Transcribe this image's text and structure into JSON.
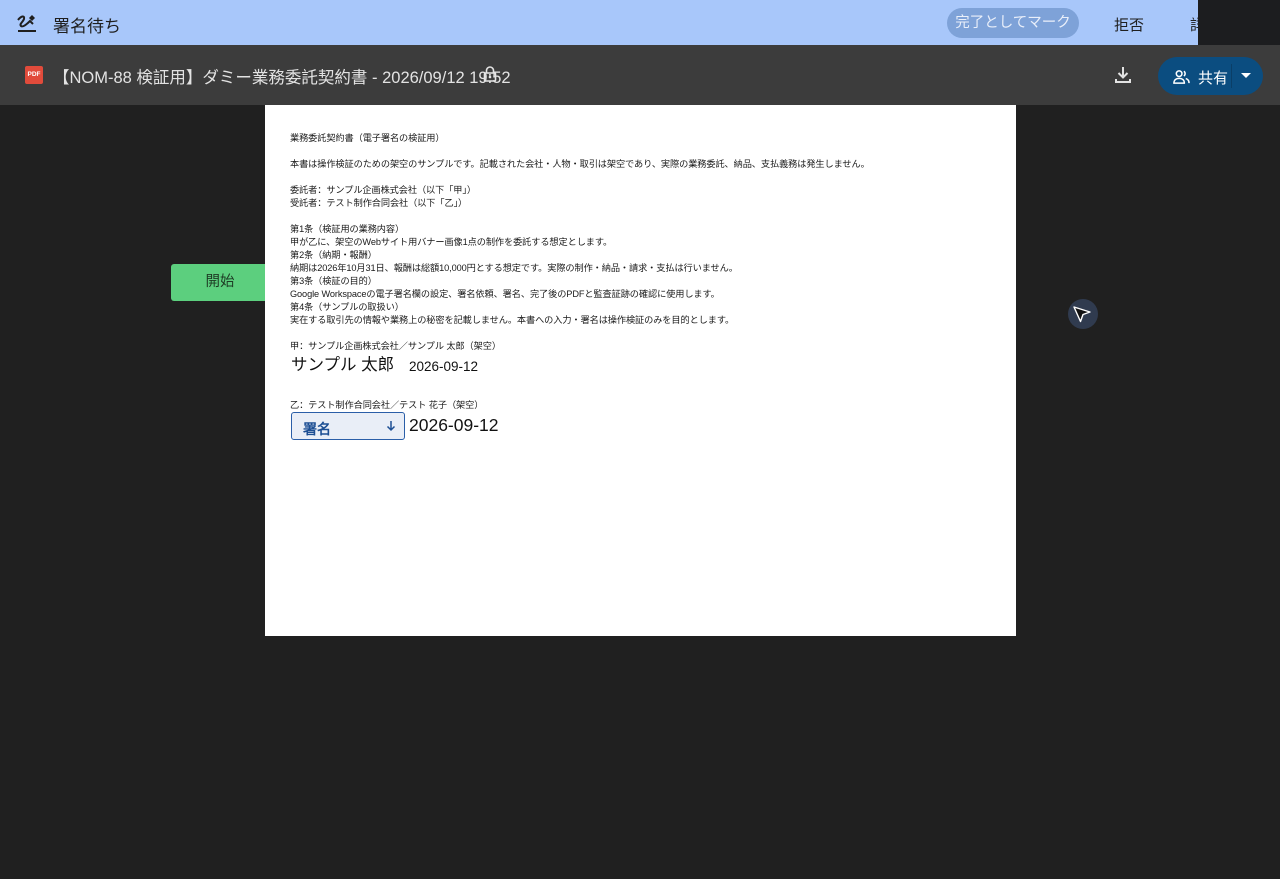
{
  "sign_bar": {
    "title": "署名待ち",
    "mark_done_label": "完了としてマーク",
    "decline_label": "拒否",
    "more_label": "詳細"
  },
  "header": {
    "file_type_badge": "PDF",
    "document_title": "【NOM-88 検証用】ダミー業務委託契約書 - 2026/09/12 19:52",
    "share_label": "共有"
  },
  "start_button_label": "開始",
  "document": {
    "lines": [
      "業務委託契約書（電子署名の検証用）",
      "本書は操作検証のための架空のサンプルです。記載された会社・人物・取引は架空であり、実際の業務委託、納品、支払義務は発生しません。",
      "委託者：サンプル企画株式会社（以下「甲」）",
      "受託者：テスト制作合同会社（以下「乙」）",
      "第1条（検証用の業務内容）",
      "甲が乙に、架空のWebサイト用バナー画像1点の制作を委託する想定とします。",
      "第2条（納期・報酬）",
      "納期は2026年10月31日、報酬は総額10,000円とする想定です。実際の制作・納品・請求・支払は行いません。",
      "第3条（検証の目的）",
      "Google Workspaceの電子署名欄の設定、署名依頼、署名、完了後のPDFと監査証跡の確認に使用します。",
      "第4条（サンプルの取扱い）",
      "実在する取引先の情報や業務上の秘密を記載しません。本書への入力・署名は操作検証のみを目的とします。",
      "甲：サンプル企画株式会社／サンプル 太郎（架空）",
      "乙：テスト制作合同会社／テスト 花子（架空）"
    ],
    "party_a_signature": "サンプル 太郎",
    "party_a_date": "2026-09-12",
    "sign_field_label": "署名",
    "party_b_date": "2026-09-12"
  },
  "colors": {
    "sign_bar_bg": "#a8c7fa",
    "header_bg": "#3c3c3c",
    "start_button_bg": "#5ccf7e",
    "share_button_bg": "#0b4d80",
    "viewer_bg": "#202020"
  },
  "icons": [
    "signature-icon",
    "pdf-icon",
    "lock-icon",
    "download-icon",
    "people-icon",
    "caret-down-icon",
    "arrow-down-icon",
    "cursor-icon"
  ]
}
